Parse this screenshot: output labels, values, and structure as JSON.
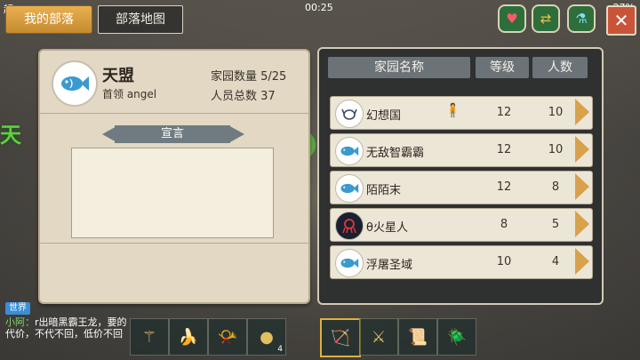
{
  "status": {
    "speed": "超 11.6 KB/s",
    "time": "00:25",
    "battery": "27%"
  },
  "tabs": {
    "mine": "我的部落",
    "map": "部落地图"
  },
  "tribe": {
    "name": "天盟",
    "leader": "首领 angel",
    "home_count": "家园数量 5/25",
    "members": "人员总数 37",
    "declaration_title": "宣言",
    "declaration_text": ""
  },
  "table": {
    "headers": [
      "家园名称",
      "等级",
      "人数"
    ],
    "rows": [
      {
        "name": "幻想国",
        "level": "12",
        "count": "10",
        "icon": "crab-icon",
        "badge": "person-icon"
      },
      {
        "name": "无敌智霸霸",
        "level": "12",
        "count": "10",
        "icon": "fish-icon"
      },
      {
        "name": "陌陌末",
        "level": "12",
        "count": "8",
        "icon": "fish-icon"
      },
      {
        "name": "θ火星人",
        "level": "8",
        "count": "5",
        "icon": "octopus-icon"
      },
      {
        "name": "浮屠圣域",
        "level": "10",
        "count": "4",
        "icon": "fish-icon"
      }
    ]
  },
  "chat": {
    "channel": "世界",
    "user": "小阿：",
    "message": "r出暗黑霸王龙，要的代价，不代不回，低价不回"
  },
  "hotbar": {
    "stack_count": "4"
  },
  "colors": {
    "accent_gold": "#d9a14c",
    "panel": "#e2d8c4",
    "dark_panel": "#2f3030"
  }
}
